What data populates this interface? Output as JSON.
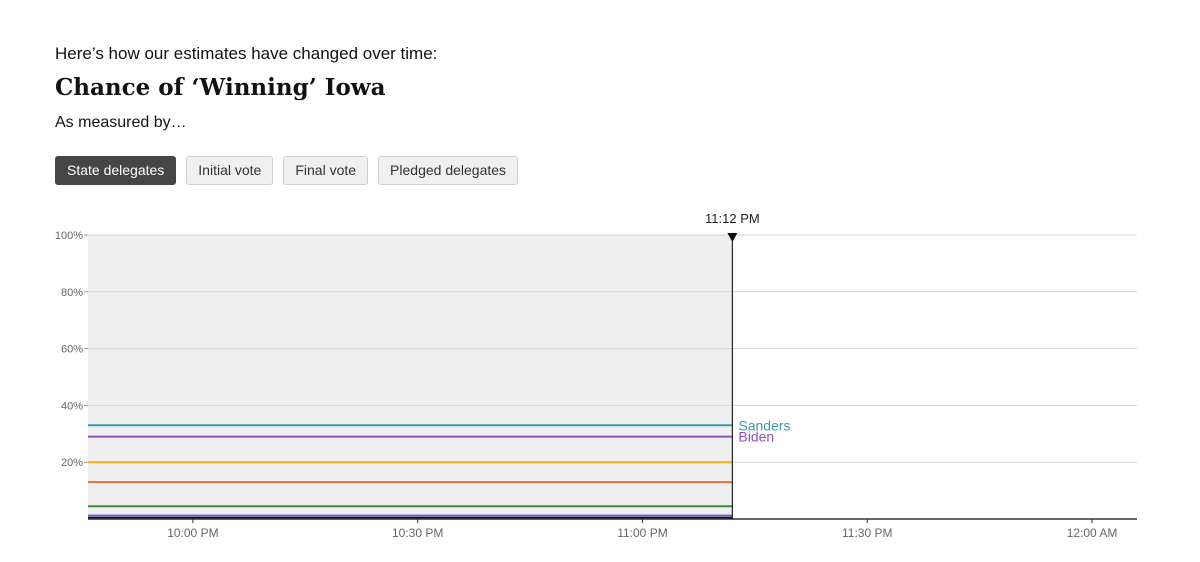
{
  "intro": "Here’s how our estimates have changed over time:",
  "headline": "Chance of ‘Winning’ Iowa",
  "measured_by": "As measured by…",
  "tabs": [
    {
      "label": "State delegates",
      "active": true
    },
    {
      "label": "Initial vote",
      "active": false
    },
    {
      "label": "Final vote",
      "active": false
    },
    {
      "label": "Pledged delegates",
      "active": false
    }
  ],
  "chart_data": {
    "type": "line",
    "title": "Chance of ‘Winning’ Iowa",
    "xlabel": "",
    "ylabel": "",
    "x_range": [
      "9:46 PM",
      "12:06 AM"
    ],
    "ylim": [
      0,
      100
    ],
    "y_ticks": [
      {
        "value": 100,
        "label": "100%"
      },
      {
        "value": 80,
        "label": "80%"
      },
      {
        "value": 60,
        "label": "60%"
      },
      {
        "value": 40,
        "label": "40%"
      },
      {
        "value": 20,
        "label": "20%"
      }
    ],
    "x_ticks": [
      {
        "value": "10:00 PM",
        "label": "10:00 PM"
      },
      {
        "value": "10:30 PM",
        "label": "10:30 PM"
      },
      {
        "value": "11:00 PM",
        "label": "11:00 PM"
      },
      {
        "value": "11:30 PM",
        "label": "11:30 PM"
      },
      {
        "value": "12:00 AM",
        "label": "12:00 AM"
      }
    ],
    "current_time": {
      "value": "11:12 PM",
      "label": "11:12 PM"
    },
    "grid": true,
    "series": [
      {
        "name": "Sanders",
        "color": "#3a9aa8",
        "labeled": true,
        "points": [
          {
            "x": "9:46 PM",
            "y": 33
          },
          {
            "x": "11:12 PM",
            "y": 33
          }
        ]
      },
      {
        "name": "Biden",
        "color": "#8e4fb8",
        "labeled": true,
        "points": [
          {
            "x": "9:46 PM",
            "y": 29
          },
          {
            "x": "11:12 PM",
            "y": 29
          }
        ]
      },
      {
        "color": "#f2ae1c",
        "labeled": false,
        "points": [
          {
            "x": "9:46 PM",
            "y": 20
          },
          {
            "x": "11:12 PM",
            "y": 20
          }
        ]
      },
      {
        "color": "#e0703c",
        "labeled": false,
        "points": [
          {
            "x": "9:46 PM",
            "y": 13
          },
          {
            "x": "11:12 PM",
            "y": 13
          }
        ]
      },
      {
        "color": "#3a8c3a",
        "labeled": false,
        "points": [
          {
            "x": "9:46 PM",
            "y": 4.5
          },
          {
            "x": "11:12 PM",
            "y": 4.5
          }
        ]
      },
      {
        "color": "#6a5acd",
        "labeled": false,
        "points": [
          {
            "x": "9:46 PM",
            "y": 1.2
          },
          {
            "x": "11:12 PM",
            "y": 1.2
          }
        ]
      },
      {
        "color": "#111111",
        "labeled": false,
        "points": [
          {
            "x": "9:46 PM",
            "y": 0.4
          },
          {
            "x": "11:12 PM",
            "y": 0.4
          }
        ]
      }
    ]
  }
}
